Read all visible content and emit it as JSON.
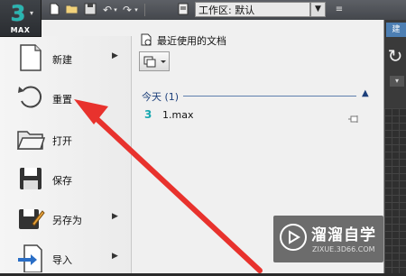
{
  "app_button": {
    "logo": "3",
    "label": "MAX"
  },
  "quick_access": {
    "icons": [
      "new-icon",
      "open-icon",
      "save-icon",
      "undo-icon",
      "redo-icon",
      "project-folder-icon"
    ],
    "workspace_label": "工作区: 默认"
  },
  "menu": {
    "items": [
      {
        "label": "新建",
        "icon": "new-document-icon",
        "has_submenu": true
      },
      {
        "label": "重置",
        "icon": "reset-icon",
        "has_submenu": false
      },
      {
        "label": "打开",
        "icon": "open-folder-icon",
        "has_submenu": false
      },
      {
        "label": "保存",
        "icon": "save-disk-icon",
        "has_submenu": false
      },
      {
        "label": "另存为",
        "icon": "save-as-icon",
        "has_submenu": true
      },
      {
        "label": "导入",
        "icon": "import-icon",
        "has_submenu": true
      }
    ]
  },
  "recent": {
    "title": "最近使用的文档",
    "group": {
      "label": "今天 (1)"
    },
    "files": [
      {
        "name": "1.max"
      }
    ]
  },
  "watermark": {
    "text": "溜溜自学",
    "sub": "ZIXUE.3D66.COM"
  },
  "colors": {
    "accent_teal": "#29b6b0",
    "annotation_red": "#e8322d",
    "group_blue": "#1c3f7a"
  }
}
